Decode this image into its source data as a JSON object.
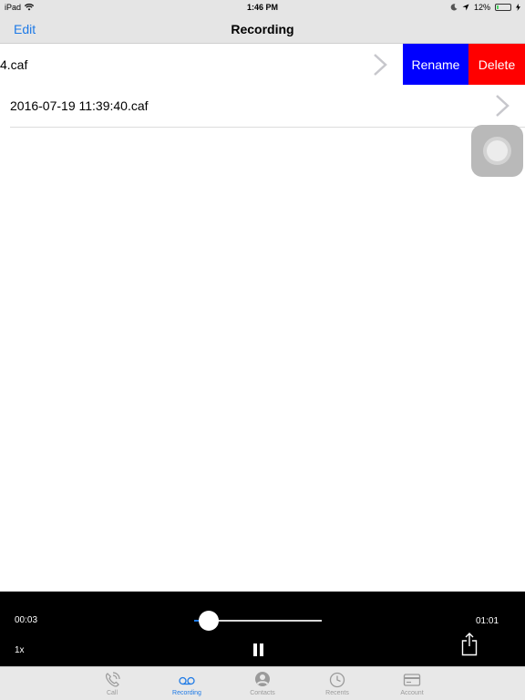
{
  "status_bar": {
    "device": "iPad",
    "time": "1:46 PM",
    "battery_percent": "12%",
    "battery_level": 0.12
  },
  "nav": {
    "edit_label": "Edit",
    "title": "Recording"
  },
  "recordings": [
    {
      "name": "4.caf",
      "actions": {
        "rename": "Rename",
        "delete": "Delete"
      }
    },
    {
      "name": "2016-07-19 11:39:40.caf"
    }
  ],
  "player": {
    "elapsed": "00:03",
    "total": "01:01",
    "speed": "1x",
    "progress": 0.05
  },
  "tabs": [
    {
      "label": "Call",
      "icon": "phone-icon",
      "active": false
    },
    {
      "label": "Recording",
      "icon": "voicemail-icon",
      "active": true
    },
    {
      "label": "Contacts",
      "icon": "person-icon",
      "active": false
    },
    {
      "label": "Recents",
      "icon": "clock-icon",
      "active": false
    },
    {
      "label": "Account",
      "icon": "card-icon",
      "active": false
    }
  ],
  "colors": {
    "accent": "#1e7ae6",
    "rename": "#0000ff",
    "delete": "#ff0000",
    "player_bg": "#000000"
  }
}
